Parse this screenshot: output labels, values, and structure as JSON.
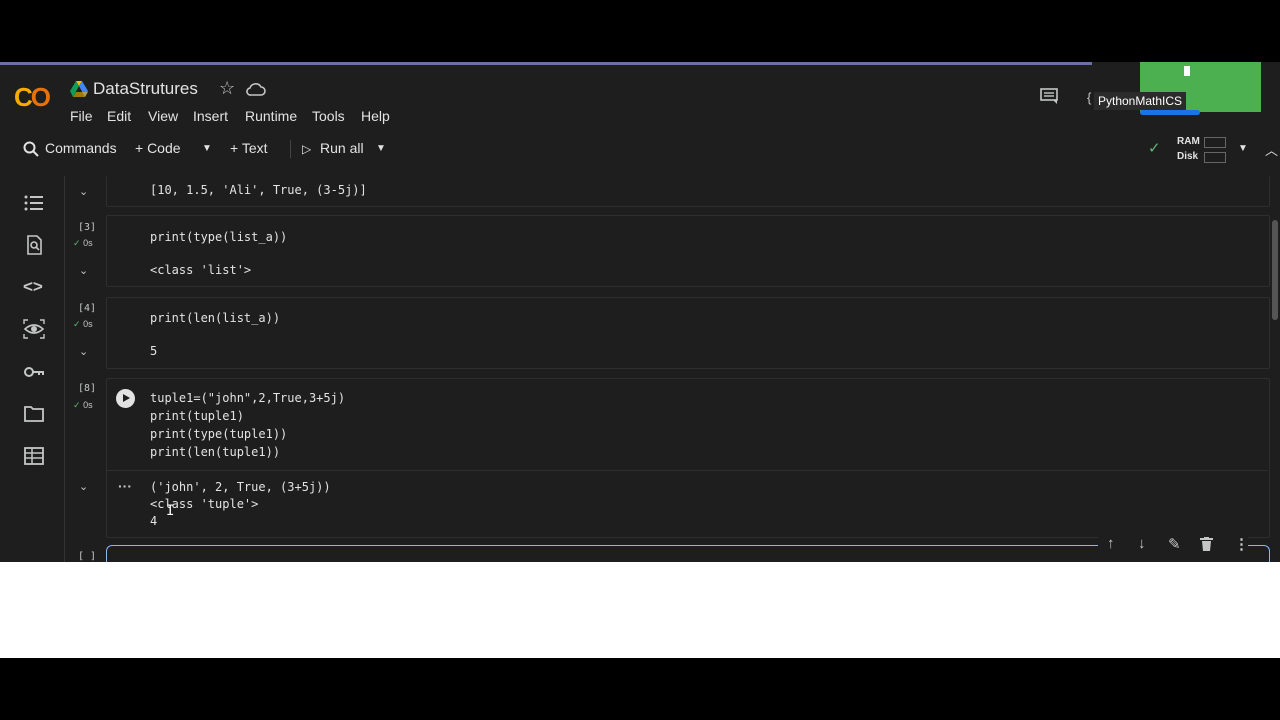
{
  "app": {
    "logo_text": "CO",
    "notebook_title": "DataStrutures",
    "colors": {
      "logo_yellow": "#f9ab00",
      "logo_orange": "#e8710a",
      "accent_blue": "#1a73e8",
      "green": "#4caf50"
    }
  },
  "menu": {
    "items": [
      "File",
      "Edit",
      "View",
      "Insert",
      "Runtime",
      "Tools",
      "Help"
    ]
  },
  "user": {
    "tag": "PythonMathICS"
  },
  "toolbar": {
    "commands": "Commands",
    "code": "+ Code",
    "text": "+ Text",
    "run_all": "Run all",
    "ram": "RAM",
    "disk": "Disk"
  },
  "cells": [
    {
      "output": "[10, 1.5, 'Ali', True, (3-5j)]"
    },
    {
      "exec": "[3]",
      "time": "0s",
      "code": "print(type(list_a))",
      "output": "<class 'list'>"
    },
    {
      "exec": "[4]",
      "time": "0s",
      "code": "print(len(list_a))",
      "output": "5"
    },
    {
      "exec": "[8]",
      "time": "0s",
      "code_lines": [
        "tuple1=(\"john\",2,True,3+5j)",
        "print(tuple1)",
        "print(type(tuple1))",
        "print(len(tuple1))"
      ],
      "output_lines": [
        "('john', 2, True, (3+5j))",
        "<class 'tuple'>",
        "4"
      ]
    },
    {
      "exec": "[ ]"
    }
  ]
}
